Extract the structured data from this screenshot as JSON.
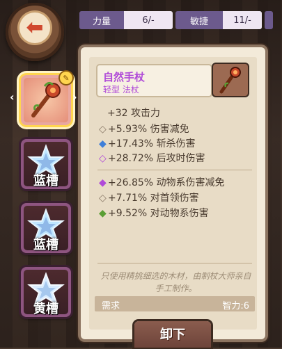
{
  "stats_bar": [
    {
      "label": "力量",
      "value": "6/-"
    },
    {
      "label": "敏捷",
      "value": "11/-"
    }
  ],
  "slots": [
    {
      "label": "",
      "state": "selected",
      "icon": "staff-icon"
    },
    {
      "label": "蓝槽",
      "icon": "crystal-star-icon"
    },
    {
      "label": "蓝槽",
      "icon": "crystal-star-icon"
    },
    {
      "label": "黄槽",
      "icon": "crystal-star-icon"
    }
  ],
  "item": {
    "name": "自然手杖",
    "type": "轻型 法杖",
    "base_stat": "+32 攻击力",
    "attributes_1": [
      {
        "bullet": "◇",
        "color": "#8a7a68",
        "text": "+5.93% 伤害减免"
      },
      {
        "bullet": "◆",
        "color": "#3f7fd8",
        "text": "+17.43% 斩杀伤害"
      },
      {
        "bullet": "◇",
        "color": "#b04ad8",
        "text": "+28.72% 后攻时伤害"
      }
    ],
    "attributes_2": [
      {
        "bullet": "◆",
        "color": "#b04ad8",
        "text": "+26.85% 动物系伤害减免"
      },
      {
        "bullet": "◇",
        "color": "#8a7a68",
        "text": "+7.71% 对首领伤害"
      },
      {
        "bullet": "◆",
        "color": "#5a9e34",
        "text": "+9.52% 对动物系伤害"
      }
    ],
    "description": "只使用精挑细选的木材，由制杖大师亲自手工制作。",
    "requirement_label": "需求",
    "requirement_value": "智力:6"
  },
  "unequip_label": "卸下"
}
